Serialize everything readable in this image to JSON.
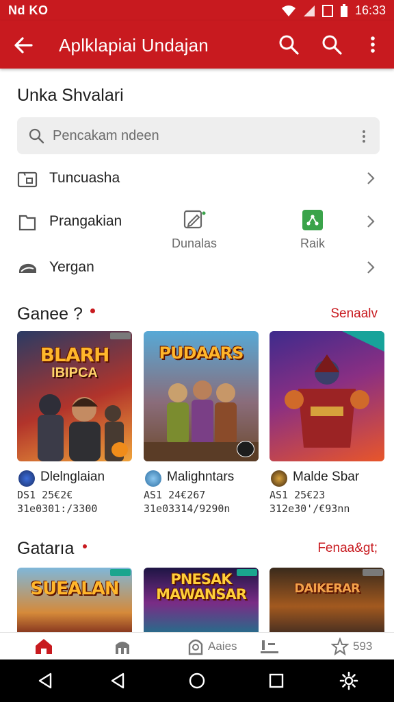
{
  "status": {
    "left_text": "Nd KO",
    "time": "16:33"
  },
  "appbar": {
    "title": "Aplklapiai Undajan"
  },
  "header": {
    "title": "Unka Shvalari"
  },
  "search": {
    "placeholder": "Pencakam ndeen"
  },
  "rows": [
    {
      "label": "Tuncuasha"
    },
    {
      "label": "Prangakian"
    },
    {
      "label": "Yergan"
    }
  ],
  "quick_actions": [
    {
      "label": "Dunalas",
      "icon": "edit-icon"
    },
    {
      "label": "Raik",
      "icon": "share-icon",
      "color": "#3aa34a"
    }
  ],
  "section1": {
    "title": "Ganee ?",
    "see_all": "Senaalv"
  },
  "section2": {
    "title": "Gatarıa",
    "see_all": "Fenaa&gt;"
  },
  "games_row1": [
    {
      "cover_title": "BLARH",
      "cover_sub": "IBIPCA",
      "name": "Dlelnglaian",
      "meta1": "DS1 25€2€",
      "meta2": "31e0301:/3300"
    },
    {
      "cover_title": "PUDAARS",
      "cover_sub": "",
      "name": "Malighntars",
      "meta1": "AS1 24€267",
      "meta2": "31e03314/9290n"
    },
    {
      "cover_title": "",
      "cover_sub": "",
      "name": "Malde Sbar",
      "meta1": "AS1 25€23",
      "meta2": "312e30'/€93nn"
    }
  ],
  "games_row2": [
    {
      "cover_title": "SUEALAN"
    },
    {
      "cover_title": "PNESAK MAWANSAR"
    },
    {
      "cover_title": "DAIKERAR"
    }
  ],
  "bottom_nav": [
    {
      "label": "",
      "icon": "home-icon"
    },
    {
      "label": "",
      "icon": "apps-icon"
    },
    {
      "label": "Aaies",
      "icon": "games-icon"
    },
    {
      "label": "",
      "icon": "library-icon"
    },
    {
      "label": "593",
      "icon": "star-icon"
    }
  ],
  "colors": {
    "primary": "#c81a1f",
    "surface": "#ffffff",
    "search_bg": "#eeeeee"
  }
}
